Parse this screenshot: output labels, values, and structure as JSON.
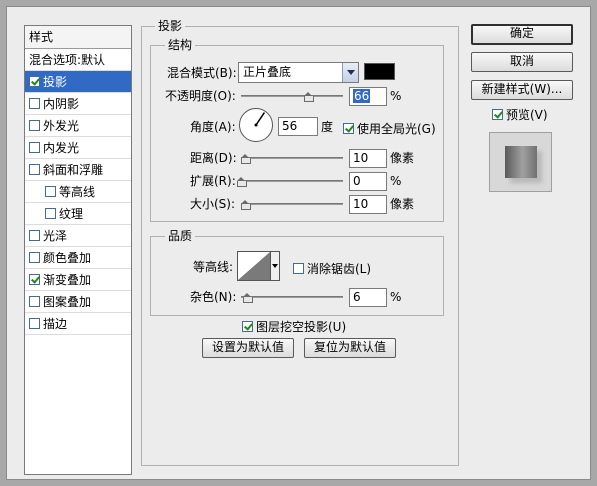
{
  "styles_panel": {
    "header": "样式",
    "items": [
      {
        "label": "混合选项:默认",
        "checkbox": false,
        "checked": false,
        "selected": false,
        "sub": false
      },
      {
        "label": "投影",
        "checkbox": true,
        "checked": true,
        "selected": true,
        "sub": false
      },
      {
        "label": "内阴影",
        "checkbox": true,
        "checked": false,
        "selected": false,
        "sub": false
      },
      {
        "label": "外发光",
        "checkbox": true,
        "checked": false,
        "selected": false,
        "sub": false
      },
      {
        "label": "内发光",
        "checkbox": true,
        "checked": false,
        "selected": false,
        "sub": false
      },
      {
        "label": "斜面和浮雕",
        "checkbox": true,
        "checked": false,
        "selected": false,
        "sub": false
      },
      {
        "label": "等高线",
        "checkbox": true,
        "checked": false,
        "selected": false,
        "sub": true
      },
      {
        "label": "纹理",
        "checkbox": true,
        "checked": false,
        "selected": false,
        "sub": true
      },
      {
        "label": "光泽",
        "checkbox": true,
        "checked": false,
        "selected": false,
        "sub": false
      },
      {
        "label": "颜色叠加",
        "checkbox": true,
        "checked": false,
        "selected": false,
        "sub": false
      },
      {
        "label": "渐变叠加",
        "checkbox": true,
        "checked": true,
        "selected": false,
        "sub": false
      },
      {
        "label": "图案叠加",
        "checkbox": true,
        "checked": false,
        "selected": false,
        "sub": false
      },
      {
        "label": "描边",
        "checkbox": true,
        "checked": false,
        "selected": false,
        "sub": false
      }
    ]
  },
  "drop_shadow": {
    "title": "投影",
    "structure": {
      "title": "结构",
      "blend_mode_label": "混合模式(B):",
      "blend_mode_value": "正片叠底",
      "shadow_color": "#000000",
      "opacity_label": "不透明度(O):",
      "opacity_value": "66",
      "opacity_unit": "%",
      "opacity_fraction": 0.66,
      "angle_label": "角度(A):",
      "angle_value": "56",
      "angle_unit": "度",
      "use_global_light_label": "使用全局光(G)",
      "use_global_light_checked": true,
      "distance_label": "距离(D):",
      "distance_value": "10",
      "distance_unit": "像素",
      "distance_fraction": 0.04,
      "spread_label": "扩展(R):",
      "spread_value": "0",
      "spread_unit": "%",
      "spread_fraction": 0.0,
      "size_label": "大小(S):",
      "size_value": "10",
      "size_unit": "像素",
      "size_fraction": 0.04
    },
    "quality": {
      "title": "品质",
      "contour_label": "等高线:",
      "anti_alias_label": "消除锯齿(L)",
      "anti_alias_checked": false,
      "noise_label": "杂色(N):",
      "noise_value": "6",
      "noise_unit": "%",
      "noise_fraction": 0.06
    },
    "layer_knocks_out_label": "图层挖空投影(U)",
    "layer_knocks_out_checked": true,
    "make_default_label": "设置为默认值",
    "reset_default_label": "复位为默认值"
  },
  "side_buttons": {
    "ok": "确定",
    "cancel": "取消",
    "new_style": "新建样式(W)...",
    "preview_label": "预览(V)",
    "preview_checked": true
  }
}
